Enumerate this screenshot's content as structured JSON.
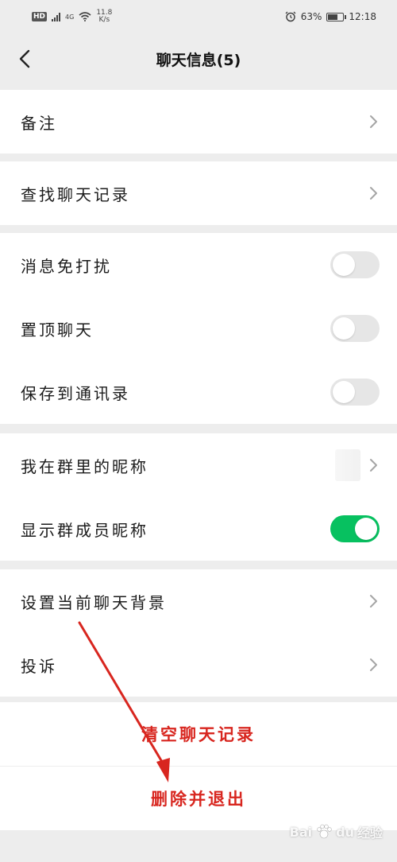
{
  "status": {
    "hd": "HD",
    "network": "4G",
    "speed_value": "11.8",
    "speed_unit": "K/s",
    "battery": "63%",
    "time": "12:18",
    "battery_level": 0.63
  },
  "nav": {
    "title": "聊天信息(5)",
    "back_icon": "chevron-left-icon"
  },
  "settings": {
    "remark": "备注",
    "search_history": "查找聊天记录",
    "mute": {
      "label": "消息免打扰",
      "on": false
    },
    "sticky": {
      "label": "置顶聊天",
      "on": false
    },
    "save_contacts": {
      "label": "保存到通讯录",
      "on": false
    },
    "my_nickname": "我在群里的昵称",
    "show_nicknames": {
      "label": "显示群成员昵称",
      "on": true
    },
    "background": "设置当前聊天背景",
    "complain": "投诉"
  },
  "actions": {
    "clear_history": "清空聊天记录",
    "delete_exit": "删除并退出"
  },
  "watermark": {
    "text_bai": "Bai",
    "text_du": "du",
    "text_jingyan": "经验"
  },
  "colors": {
    "toggle_on": "#07c160",
    "annotation": "#d8261f",
    "background": "#ededed"
  }
}
